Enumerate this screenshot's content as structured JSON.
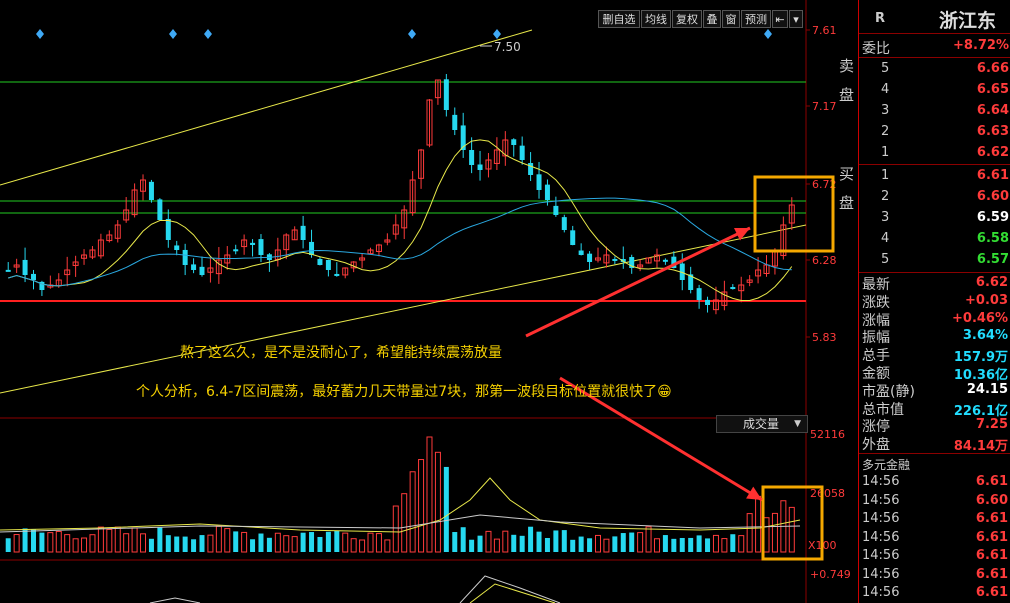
{
  "toolbar": {
    "buttons": [
      "删自选",
      "均线",
      "复权",
      "叠",
      "窗",
      "预测",
      "⇤",
      "▾"
    ]
  },
  "price_axis": [
    "7.61",
    "7.17",
    "6.72",
    "6.28",
    "5.83"
  ],
  "volume_axis": [
    "52116",
    "26058",
    "X100"
  ],
  "macd_axis": [
    "+0.749"
  ],
  "peak_label": "7.50",
  "annotations": {
    "line1": "熬了这么久，是不是没耐心了，希望能持续震荡放量",
    "line2": "个人分析，6.4-7区间震荡，最好蓄力几天带量过7块，那第一波段目标位置就很快了😁"
  },
  "volume_panel": {
    "label": "成交量"
  },
  "colors": {
    "up": "#ff3b3b",
    "down": "#26d9f0",
    "ma5": "#e8e84a",
    "ma20": "#2aa8e0",
    "highlight": "#f5a800",
    "arrow": "#ff3030"
  },
  "stock": {
    "flag": "R",
    "name": "浙江东"
  },
  "order_ratio": {
    "label": "委比",
    "value": "+8.72%"
  },
  "sell_side_label": "卖盘",
  "buy_side_label": "买盘",
  "sell_levels": [
    {
      "n": "5",
      "price": "6.66"
    },
    {
      "n": "4",
      "price": "6.65"
    },
    {
      "n": "3",
      "price": "6.64"
    },
    {
      "n": "2",
      "price": "6.63"
    },
    {
      "n": "1",
      "price": "6.62"
    }
  ],
  "buy_levels": [
    {
      "n": "1",
      "price": "6.61",
      "color": "red"
    },
    {
      "n": "2",
      "price": "6.60",
      "color": "red"
    },
    {
      "n": "3",
      "price": "6.59",
      "color": "white"
    },
    {
      "n": "4",
      "price": "6.58",
      "color": "green"
    },
    {
      "n": "5",
      "price": "6.57",
      "color": "green"
    }
  ],
  "stats": [
    {
      "label": "最新",
      "value": "6.62",
      "color": "red"
    },
    {
      "label": "涨跌",
      "value": "+0.03",
      "color": "red"
    },
    {
      "label": "涨幅",
      "value": "+0.46%",
      "color": "red"
    },
    {
      "label": "振幅",
      "value": "3.64%",
      "color": "cyan"
    },
    {
      "label": "总手",
      "value": "157.9万",
      "color": "cyan"
    },
    {
      "label": "金额",
      "value": "10.36亿",
      "color": "cyan"
    },
    {
      "label": "市盈(静)",
      "value": "24.15",
      "color": "white"
    },
    {
      "label": "总市值",
      "value": "226.1亿",
      "color": "cyan"
    },
    {
      "label": "涨停",
      "value": "7.25",
      "color": "red"
    },
    {
      "label": "外盘",
      "value": "84.14万",
      "color": "red"
    }
  ],
  "ticks_header": "多元金融",
  "ticks": [
    {
      "time": "14:56",
      "price": "6.61"
    },
    {
      "time": "14:56",
      "price": "6.60"
    },
    {
      "time": "14:56",
      "price": "6.61"
    },
    {
      "time": "14:56",
      "price": "6.61"
    },
    {
      "time": "14:56",
      "price": "6.61"
    },
    {
      "time": "14:56",
      "price": "6.61"
    },
    {
      "time": "14:56",
      "price": "6.61"
    }
  ]
}
